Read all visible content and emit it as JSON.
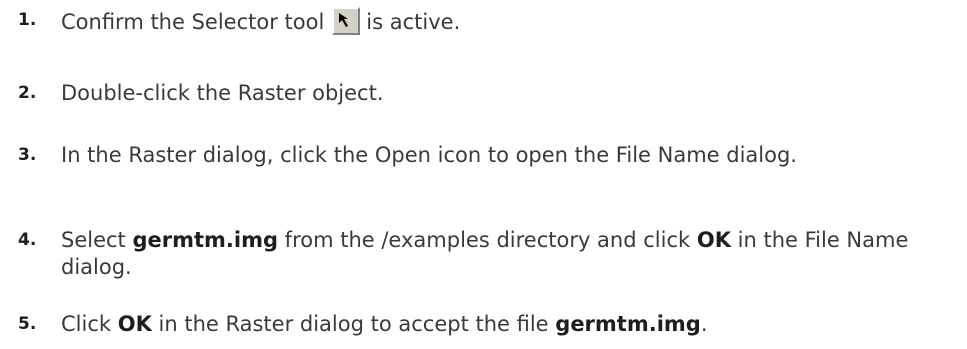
{
  "steps": [
    {
      "number": "1.",
      "text_before": "Confirm the Selector tool",
      "icon": "selector-arrow-icon",
      "text_after": "is active."
    },
    {
      "number": "2.",
      "text": "Double-click the Raster object."
    },
    {
      "number": "3.",
      "text": "In the Raster dialog, click the Open icon to open the File Name dialog."
    },
    {
      "number": "4.",
      "t1": "Select ",
      "b1": "germtm.img",
      "t2": " from the /examples directory and click ",
      "b2": "OK",
      "t3": " in the File Name dialog."
    },
    {
      "number": "5.",
      "t1": "Click ",
      "b1": "OK",
      "t2": " in the Raster dialog to accept the file ",
      "b2": "germtm.img",
      "t3": "."
    }
  ]
}
